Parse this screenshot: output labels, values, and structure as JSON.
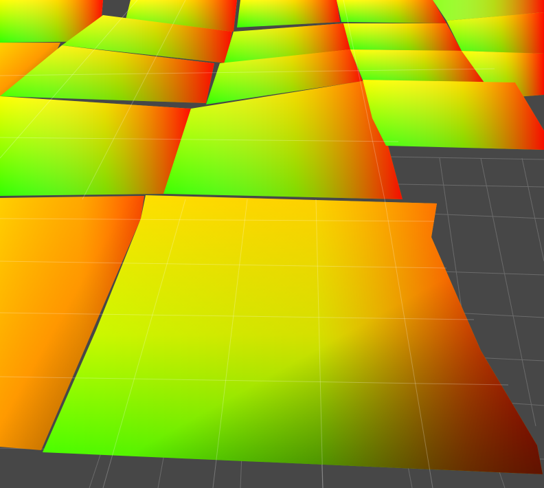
{
  "scene": {
    "background": "#474747",
    "grid_line_color": "#6b6b6b",
    "surface_colormap": [
      "#00ff00",
      "#ffff00",
      "#ff0000"
    ],
    "edge_shadow_color": "#3b3b1a",
    "icon": "heightmap-surface-icon"
  }
}
